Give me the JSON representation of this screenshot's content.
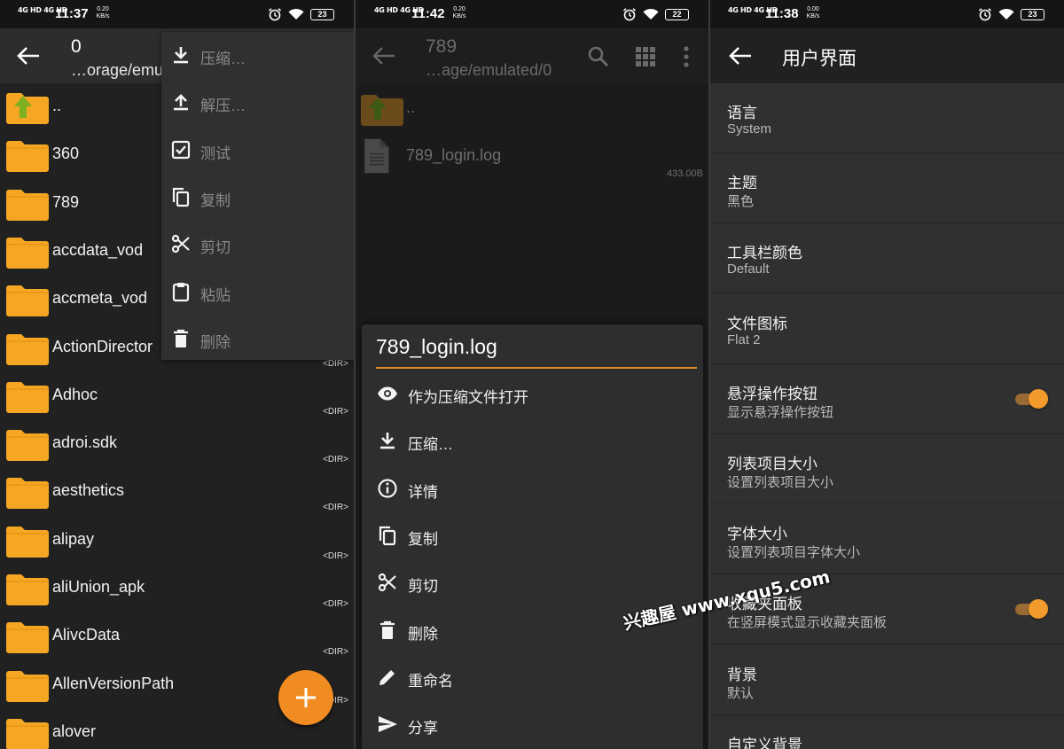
{
  "panel1": {
    "status": {
      "network": "4G HD 4G HD",
      "time": "11:37",
      "speed": "0.20 KB/s",
      "battery": "23"
    },
    "toolbar": {
      "title": "0",
      "subtitle": "…orage/emu"
    },
    "files": [
      {
        "name": "..",
        "tag": ""
      },
      {
        "name": "360",
        "tag": ""
      },
      {
        "name": "789",
        "tag": ""
      },
      {
        "name": "accdata_vod",
        "tag": ""
      },
      {
        "name": "accmeta_vod",
        "tag": ""
      },
      {
        "name": "ActionDirector",
        "tag": "<DIR>"
      },
      {
        "name": "Adhoc",
        "tag": "<DIR>"
      },
      {
        "name": "adroi.sdk",
        "tag": "<DIR>"
      },
      {
        "name": "aesthetics",
        "tag": "<DIR>"
      },
      {
        "name": "alipay",
        "tag": "<DIR>"
      },
      {
        "name": "aliUnion_apk",
        "tag": "<DIR>"
      },
      {
        "name": "AlivcData",
        "tag": "<DIR>"
      },
      {
        "name": "AllenVersionPath",
        "tag": "<DIR>"
      },
      {
        "name": "alover",
        "tag": ""
      }
    ],
    "menu": [
      {
        "label": "压缩…",
        "icon": "download-icon"
      },
      {
        "label": "解压…",
        "icon": "upload-icon"
      },
      {
        "label": "测试",
        "icon": "checkbox-icon"
      },
      {
        "label": "复制",
        "icon": "copy-icon"
      },
      {
        "label": "剪切",
        "icon": "scissors-icon"
      },
      {
        "label": "粘贴",
        "icon": "clipboard-icon"
      },
      {
        "label": "删除",
        "icon": "trash-icon"
      }
    ],
    "fab": {
      "label": "+"
    }
  },
  "panel2": {
    "status": {
      "network": "4G HD 4G HD",
      "time": "11:42",
      "speed": "0.20 KB/s",
      "battery": "22"
    },
    "toolbar": {
      "title": "789",
      "subtitle": "…age/emulated/0"
    },
    "files": [
      {
        "name": "..",
        "size": ""
      },
      {
        "name": "789_login.log",
        "size": "433.00B"
      }
    ],
    "dialog": {
      "title": "789_login.log",
      "items": [
        {
          "label": "作为压缩文件打开",
          "icon": "eye-icon"
        },
        {
          "label": "压缩…",
          "icon": "download-icon"
        },
        {
          "label": "详情",
          "icon": "info-icon"
        },
        {
          "label": "复制",
          "icon": "copy-icon"
        },
        {
          "label": "剪切",
          "icon": "scissors-icon"
        },
        {
          "label": "删除",
          "icon": "trash-icon"
        },
        {
          "label": "重命名",
          "icon": "pencil-icon"
        },
        {
          "label": "分享",
          "icon": "send-icon"
        }
      ]
    }
  },
  "panel3": {
    "status": {
      "network": "4G HD 4G HD",
      "time": "11:38",
      "speed": "0.00 KB/s",
      "battery": "23"
    },
    "toolbar": {
      "title": "用户界面"
    },
    "prefs": [
      {
        "title": "语言",
        "summary": "System",
        "toggle": false
      },
      {
        "title": "主题",
        "summary": "黑色",
        "toggle": false
      },
      {
        "title": "工具栏颜色",
        "summary": "Default",
        "toggle": false
      },
      {
        "title": "文件图标",
        "summary": "Flat 2",
        "toggle": false
      },
      {
        "title": "悬浮操作按钮",
        "summary": "显示悬浮操作按钮",
        "toggle": true
      },
      {
        "title": "列表项目大小",
        "summary": "设置列表项目大小",
        "toggle": false
      },
      {
        "title": "字体大小",
        "summary": "设置列表项目字体大小",
        "toggle": false
      },
      {
        "title": "收藏夹面板",
        "summary": "在竖屏模式显示收藏夹面板",
        "toggle": true
      },
      {
        "title": "背景",
        "summary": "默认",
        "toggle": false
      },
      {
        "title": "自定义背景",
        "summary": "",
        "toggle": false
      }
    ]
  },
  "watermark": "兴趣屋 www.xqu5.com",
  "colors": {
    "accent": "#f08c22",
    "folder": "#f5a623",
    "up_arrow": "#7cb01e"
  }
}
